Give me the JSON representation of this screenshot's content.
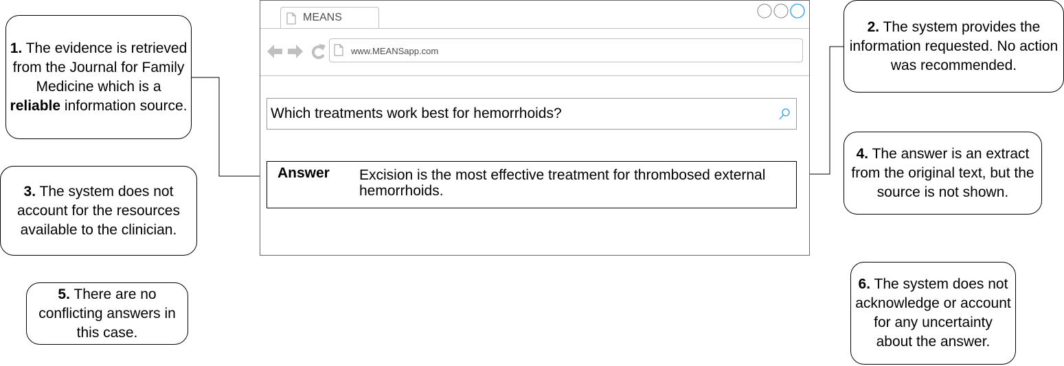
{
  "browser": {
    "tab_title": "MEANS",
    "url": "www.MEANSapp.com",
    "search_query": "Which treatments work best for hemorrhoids?",
    "answer_label": "Answer",
    "answer_text": "Excision is the most effective treatment for thrombosed external hemorrhoids.",
    "icons": {
      "document": "document-icon",
      "back": "back-arrow-icon",
      "forward": "forward-arrow-icon",
      "reload": "reload-icon",
      "search": "search-icon",
      "window_controls": "window-control-circles"
    },
    "accent_color": "#1ba1e2"
  },
  "callouts": {
    "c1": {
      "num": "1.",
      "pre": " The evidence is retrieved from the Journal for Family Medicine which is a ",
      "bold": "reliable",
      "post": " information source."
    },
    "c2": {
      "num": "2.",
      "text": " The system provides the information requested.  No action was recommended."
    },
    "c3": {
      "num": "3.",
      "text": " The system does not account for the resources available to the clinician."
    },
    "c4": {
      "num": "4.",
      "text": "  The answer is an extract from the original text, but the source is not shown."
    },
    "c5": {
      "num": "5.",
      "text": " There are no conflicting answers in this case."
    },
    "c6": {
      "num": "6.",
      "text": " The system does not acknowledge or account for any uncertainty about the answer."
    }
  }
}
